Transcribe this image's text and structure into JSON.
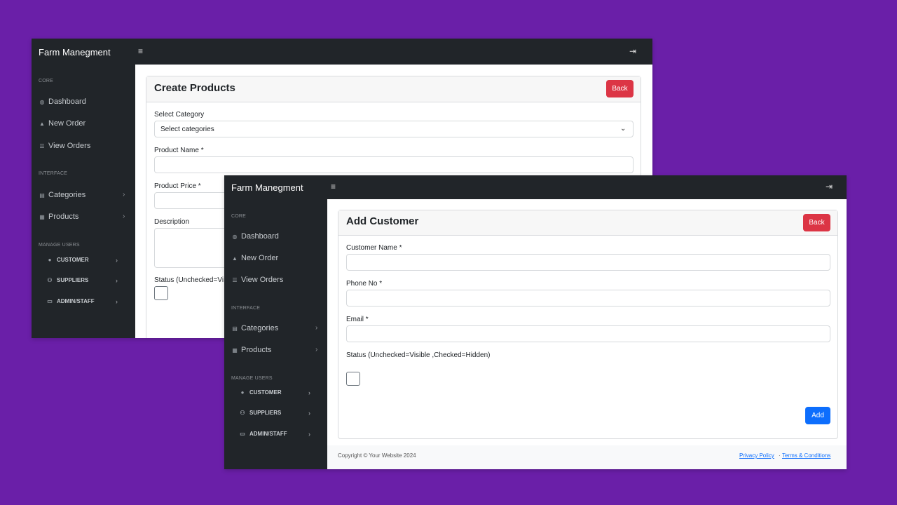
{
  "colors": {
    "background": "#6a1fa8",
    "topbar": "#212529",
    "back_button": "#dc3545",
    "add_button": "#0d6efd"
  },
  "window1": {
    "brand": "Farm Manegment",
    "hamburger": "≡",
    "logout": "⇥",
    "sidebar": {
      "core_heading": "CORE",
      "dashboard": "Dashboard",
      "new_order": "New Order",
      "view_orders": "View Orders",
      "interface_heading": "INTERFACE",
      "categories": "Categories",
      "products": "Products",
      "manage_heading": "MANAGE USERS",
      "customer": "CUSTOMER",
      "suppliers": "SUPPLIERS",
      "admin_staff": "ADMIN/STAFF"
    },
    "card": {
      "title": "Create Products",
      "back_label": "Back",
      "category_label": "Select Category",
      "category_value": "Select categories",
      "name_label": "Product Name *",
      "price_label": "Product Price *",
      "description_label": "Description",
      "status_label": "Status (Unchecked=Vi"
    }
  },
  "window2": {
    "brand": "Farm Manegment",
    "hamburger": "≡",
    "logout": "⇥",
    "sidebar": {
      "core_heading": "CORE",
      "dashboard": "Dashboard",
      "new_order": "New Order",
      "view_orders": "View Orders",
      "interface_heading": "INTERFACE",
      "categories": "Categories",
      "products": "Products",
      "manage_heading": "MANAGE USERS",
      "customer": "CUSTOMER",
      "suppliers": "SUPPLIERS",
      "admin_staff": "ADMIN/STAFF"
    },
    "card": {
      "title": "Add Customer",
      "back_label": "Back",
      "name_label": "Customer Name *",
      "phone_label": "Phone No *",
      "email_label": "Email *",
      "status_label": "Status (Unchecked=Visible ,Checked=Hidden)",
      "add_label": "Add"
    },
    "footer": {
      "copyright": "Copyright © Your Website 2024",
      "privacy": "Privacy Policy",
      "separator": "·",
      "terms": "Terms & Conditions"
    }
  },
  "icons": {
    "dashboard": "dashboard-icon",
    "new_order": "bell-icon",
    "view_orders": "list-icon",
    "categories": "archive-icon",
    "products": "table-icon",
    "customer": "user-circle-icon",
    "suppliers": "users-icon",
    "admin_staff": "id-card-icon"
  }
}
